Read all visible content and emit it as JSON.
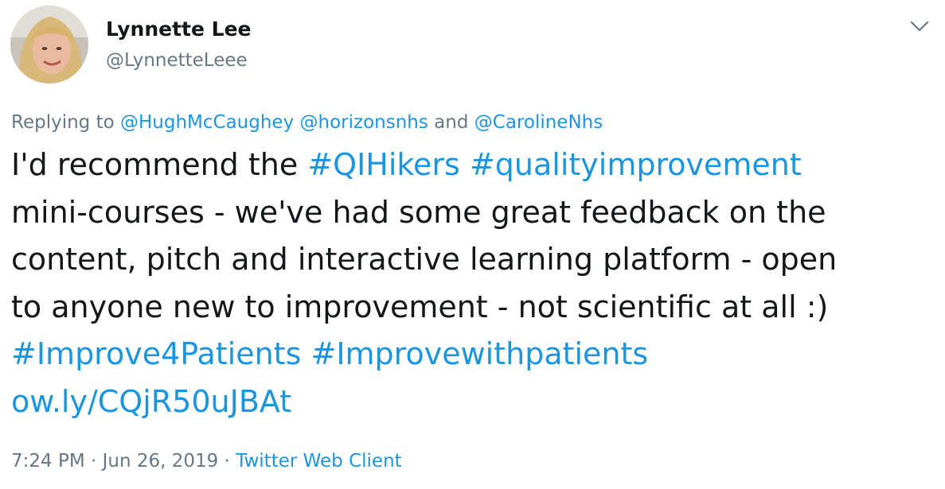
{
  "author": {
    "display_name": "Lynnette Lee",
    "handle": "@LynnetteLeee"
  },
  "reply": {
    "prefix": "Replying to ",
    "mention_1": "@HughMcCaughey",
    "mention_2": "@horizonsnhs",
    "conjunction": " and ",
    "mention_3": "@CarolineNhs"
  },
  "tweet": {
    "line1_text": "I'd recommend the ",
    "hashtag_1": "#QIHikers",
    "hashtag_2": "#qualityimprovement",
    "line2": "mini-courses - we've had some great feedback on the",
    "line3": "content, pitch and interactive learning platform - open",
    "line4": "to anyone new to improvement - not scientific at all :)",
    "hashtag_3": "#Improve4Patients",
    "hashtag_4": "#Improvewithpatients",
    "link": "ow.ly/CQjR50uJBAt"
  },
  "meta": {
    "time": "7:24 PM",
    "separator": " · ",
    "date": "Jun 26, 2019",
    "source": "Twitter Web Client"
  },
  "icons": {
    "caret": "chevron-down-icon",
    "avatar": "profile-avatar"
  },
  "colors": {
    "link": "#1b95e0",
    "secondary": "#657786",
    "text": "#14171a"
  }
}
